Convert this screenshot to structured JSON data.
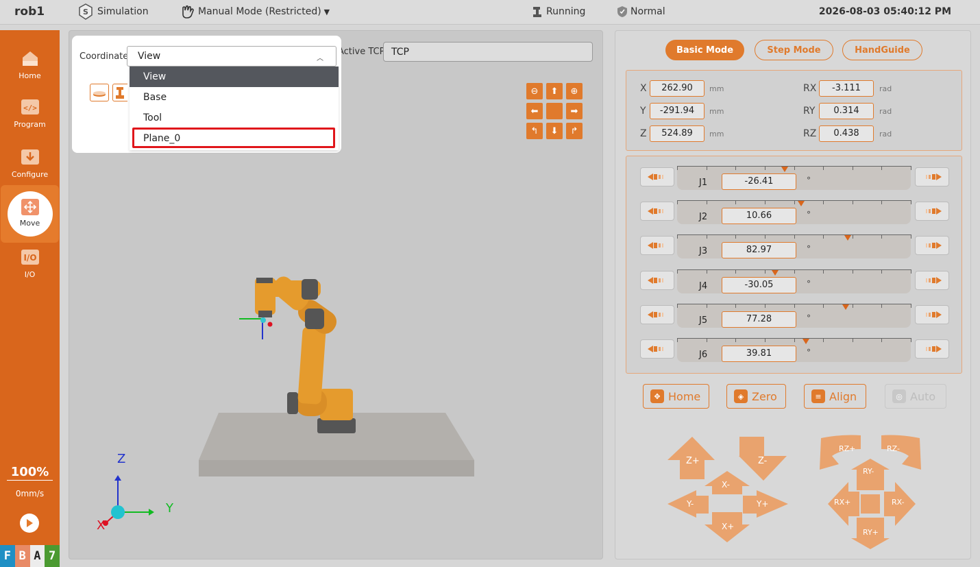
{
  "topbar": {
    "robot_name": "rob1",
    "simulation": "Simulation",
    "mode": "Manual Mode (Restricted)",
    "run_state": "Running",
    "safety": "Normal",
    "datetime": "2026-08-03 05:40:12 PM"
  },
  "sidebar": {
    "items": [
      {
        "label": "Home",
        "icon": "home-icon"
      },
      {
        "label": "Program",
        "icon": "code-icon"
      },
      {
        "label": "Configure",
        "icon": "download-tray-icon"
      },
      {
        "label": "Move",
        "icon": "move-arrows-icon"
      },
      {
        "label": "I/O",
        "icon": "io-icon"
      }
    ],
    "speed_percent": "100%",
    "speed_value": "0mm/s",
    "badges": [
      "F",
      "B",
      "A",
      "7"
    ]
  },
  "viewport": {
    "coordinate_label": "Coordinate",
    "coordinate_value": "View",
    "coordinate_options": [
      "View",
      "Base",
      "Tool",
      "Plane_0"
    ],
    "active_tcp_label": "Active TCP",
    "active_tcp_value": "TCP",
    "axes": {
      "z": "Z",
      "y": "Y",
      "x": "X"
    }
  },
  "right": {
    "modes": [
      "Basic Mode",
      "Step Mode",
      "HandGuide"
    ],
    "pose": {
      "x": {
        "label": "X",
        "value": "262.90",
        "unit": "mm"
      },
      "y": {
        "label": "Y",
        "value": "-291.94",
        "unit": "mm"
      },
      "z": {
        "label": "Z",
        "value": "524.89",
        "unit": "mm"
      },
      "rx": {
        "label": "RX",
        "value": "-3.111",
        "unit": "rad"
      },
      "ry": {
        "label": "RY",
        "value": "0.314",
        "unit": "rad"
      },
      "rz": {
        "label": "RZ",
        "value": "0.438",
        "unit": "rad"
      }
    },
    "joints": [
      {
        "label": "J1",
        "value": "-26.41",
        "unit": "°",
        "marker_fraction": 0.46
      },
      {
        "label": "J2",
        "value": "10.66",
        "unit": "°",
        "marker_fraction": 0.53
      },
      {
        "label": "J3",
        "value": "82.97",
        "unit": "°",
        "marker_fraction": 0.73
      },
      {
        "label": "J4",
        "value": "-30.05",
        "unit": "°",
        "marker_fraction": 0.42
      },
      {
        "label": "J5",
        "value": "77.28",
        "unit": "°",
        "marker_fraction": 0.72
      },
      {
        "label": "J6",
        "value": "39.81",
        "unit": "°",
        "marker_fraction": 0.55
      }
    ],
    "actions": [
      "Home",
      "Zero",
      "Align",
      "Auto"
    ],
    "jog_labels": {
      "zplus": "Z+",
      "zminus": "Z-",
      "xminus": "X-",
      "xplus": "X+",
      "yminus": "Y-",
      "yplus": "Y+",
      "rzplus": "RZ+",
      "rzminus": "RZ-",
      "ryminus": "RY-",
      "ryplus": "RY+",
      "rxplus": "RX+",
      "rxminus": "RX-"
    }
  },
  "colors": {
    "accent": "#e07a2c",
    "sidebar": "#d9661c",
    "highlight": "#e0161b"
  }
}
